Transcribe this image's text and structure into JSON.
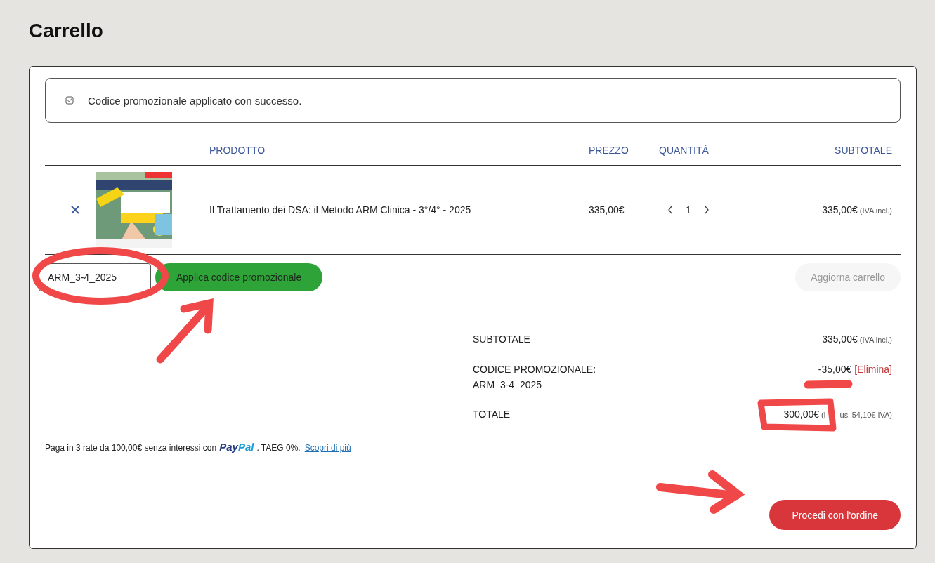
{
  "page_title": "Carrello",
  "notice": {
    "text": "Codice promozionale applicato con successo."
  },
  "table": {
    "columns": [
      "PRODOTTO",
      "PREZZO",
      "QUANTITÀ",
      "SUBTOTALE"
    ],
    "rows": [
      {
        "product": "Il Trattamento dei DSA: il Metodo ARM Clinica - 3°/4° - 2025",
        "price": "335,00€",
        "quantity": "1",
        "subtotal": "335,00€",
        "subtotal_note": "(IVA incl.)"
      }
    ]
  },
  "coupon": {
    "value": "ARM_3-4_2025",
    "apply_button": "Applica codice promozionale",
    "update_button": {
      "label": "Aggiorna carrello",
      "disabled": true
    }
  },
  "totals": [
    {
      "kind": "subtotal",
      "label": "SUBTOTALE",
      "value": "335,00€",
      "note": "(IVA incl.)"
    },
    {
      "kind": "coupon",
      "label": "CODICE PROMOZIONALE:",
      "code": "ARM_3-4_2025",
      "value": "-35,00€",
      "link": "[Elimina]"
    },
    {
      "kind": "total",
      "label": "TOTALE",
      "value": "300,00€",
      "note_start": "(i",
      "note_end": "lusi 54,10€ IVA)"
    }
  ],
  "paypal": {
    "text_before": "Paga in 3 rate da 100,00€ senza interessi con",
    "logo_first": "Pay",
    "logo_second": "Pal",
    "text_after": ". TAEG 0%.",
    "link": "Scopri di più"
  },
  "checkout_button": "Procedi con l'ordine"
}
